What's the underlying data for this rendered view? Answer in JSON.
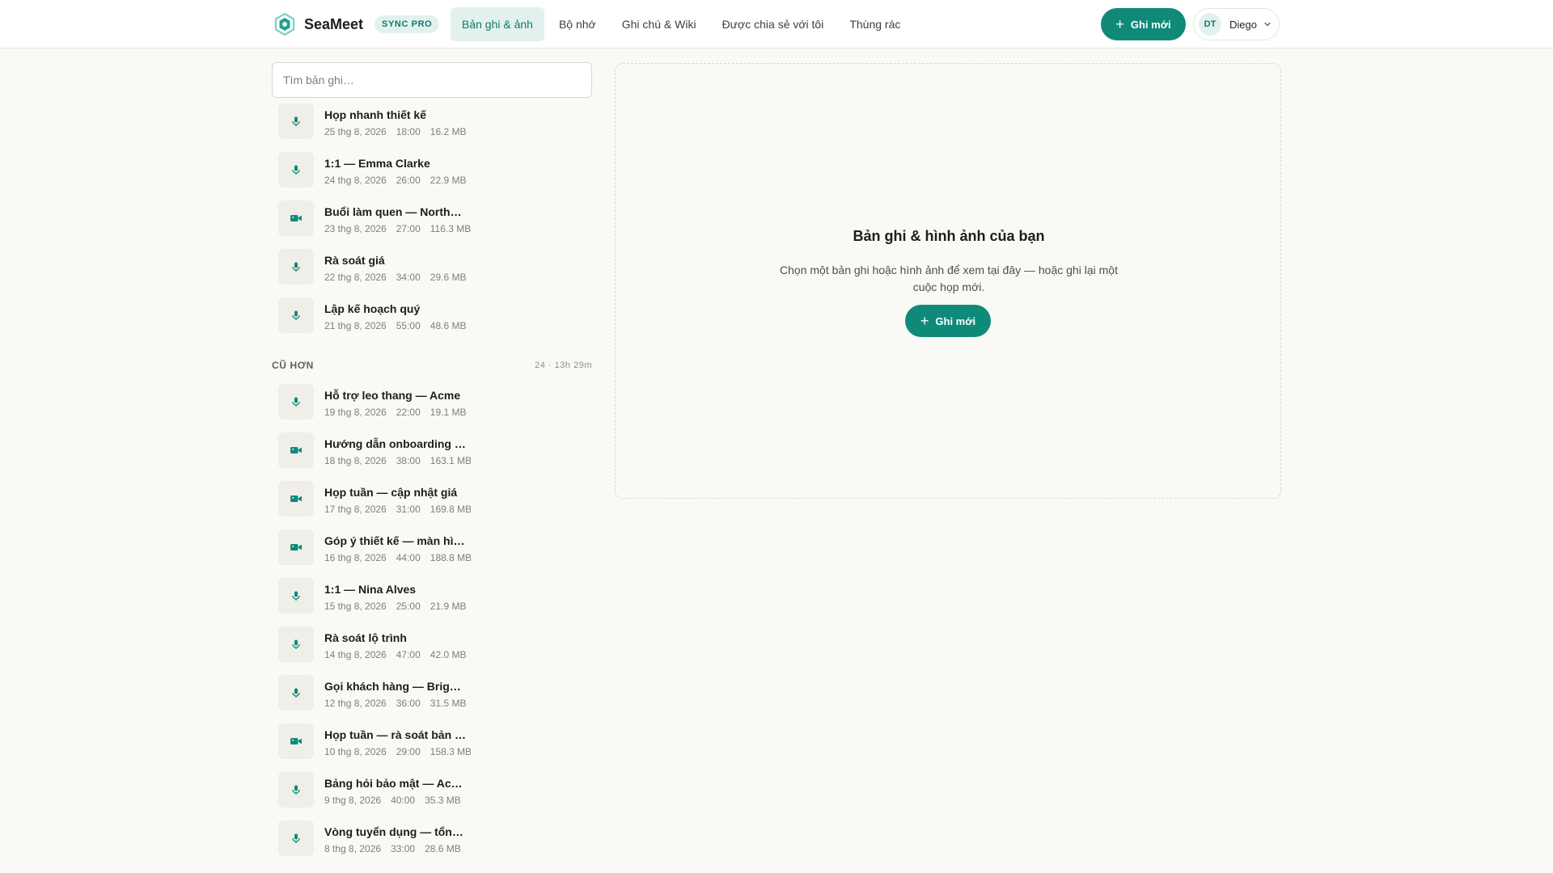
{
  "app": {
    "name": "SeaMeet",
    "badge": "SYNC PRO"
  },
  "nav": [
    {
      "label": "Bản ghi & ảnh",
      "active": true
    },
    {
      "label": "Bộ nhớ",
      "active": false
    },
    {
      "label": "Ghi chú & Wiki",
      "active": false
    },
    {
      "label": "Được chia sẻ với tôi",
      "active": false
    },
    {
      "label": "Thùng rác",
      "active": false
    }
  ],
  "header": {
    "new_button": "Ghi mới"
  },
  "user": {
    "initials": "DT",
    "name": "Diego"
  },
  "search": {
    "placeholder": "Tìm bản ghi…"
  },
  "recent": [
    {
      "title": "Họp nhanh thiết kế",
      "date": "25 thg 8, 2026",
      "duration": "18:00",
      "size": "16.2 MB",
      "kind": "mic-icon"
    },
    {
      "title": "1:1 — Emma Clarke",
      "date": "24 thg 8, 2026",
      "duration": "26:00",
      "size": "22.9 MB",
      "kind": "mic-icon"
    },
    {
      "title": "Buổi làm quen — Northwind",
      "date": "23 thg 8, 2026",
      "duration": "27:00",
      "size": "116.3 MB",
      "kind": "video-icon"
    },
    {
      "title": "Rà soát giá",
      "date": "22 thg 8, 2026",
      "duration": "34:00",
      "size": "29.6 MB",
      "kind": "mic-icon"
    },
    {
      "title": "Lập kế hoạch quý",
      "date": "21 thg 8, 2026",
      "duration": "55:00",
      "size": "48.6 MB",
      "kind": "mic-icon"
    }
  ],
  "older": {
    "title": "CŨ HƠN",
    "count": "24 · 13h 29m",
    "items": [
      {
        "title": "Hỗ trợ leo thang — Acme",
        "date": "19 thg 8, 2026",
        "duration": "22:00",
        "size": "19.1 MB",
        "kind": "mic-icon"
      },
      {
        "title": "Hướng dẫn onboarding khách hàng",
        "date": "18 thg 8, 2026",
        "duration": "38:00",
        "size": "163.1 MB",
        "kind": "video-icon"
      },
      {
        "title": "Họp tuần — cập nhật giá",
        "date": "17 thg 8, 2026",
        "duration": "31:00",
        "size": "169.8 MB",
        "kind": "video-icon"
      },
      {
        "title": "Góp ý thiết kế — màn hình chính",
        "date": "16 thg 8, 2026",
        "duration": "44:00",
        "size": "188.8 MB",
        "kind": "video-icon"
      },
      {
        "title": "1:1 — Nina Alves",
        "date": "15 thg 8, 2026",
        "duration": "25:00",
        "size": "21.9 MB",
        "kind": "mic-icon"
      },
      {
        "title": "Rà soát lộ trình",
        "date": "14 thg 8, 2026",
        "duration": "47:00",
        "size": "42.0 MB",
        "kind": "mic-icon"
      },
      {
        "title": "Gọi khách hàng — Brightline",
        "date": "12 thg 8, 2026",
        "duration": "36:00",
        "size": "31.5 MB",
        "kind": "mic-icon"
      },
      {
        "title": "Họp tuần — rà soát bản phát hành",
        "date": "10 thg 8, 2026",
        "duration": "29:00",
        "size": "158.3 MB",
        "kind": "video-icon"
      },
      {
        "title": "Bảng hỏi bảo mật — Acme",
        "date": "9 thg 8, 2026",
        "duration": "40:00",
        "size": "35.3 MB",
        "kind": "mic-icon"
      },
      {
        "title": "Vòng tuyển dụng — tổng kết",
        "date": "8 thg 8, 2026",
        "duration": "33:00",
        "size": "28.6 MB",
        "kind": "mic-icon"
      }
    ]
  },
  "empty": {
    "title": "Bản ghi & hình ảnh của bạn",
    "description": "Chọn một bản ghi hoặc hình ảnh để xem tại đây — hoặc ghi lại một cuộc họp mới.",
    "button": "Ghi mới"
  },
  "colors": {
    "accent": "#0f8a79",
    "accent_soft": "#e3f1ee",
    "background": "#faf9f6"
  }
}
